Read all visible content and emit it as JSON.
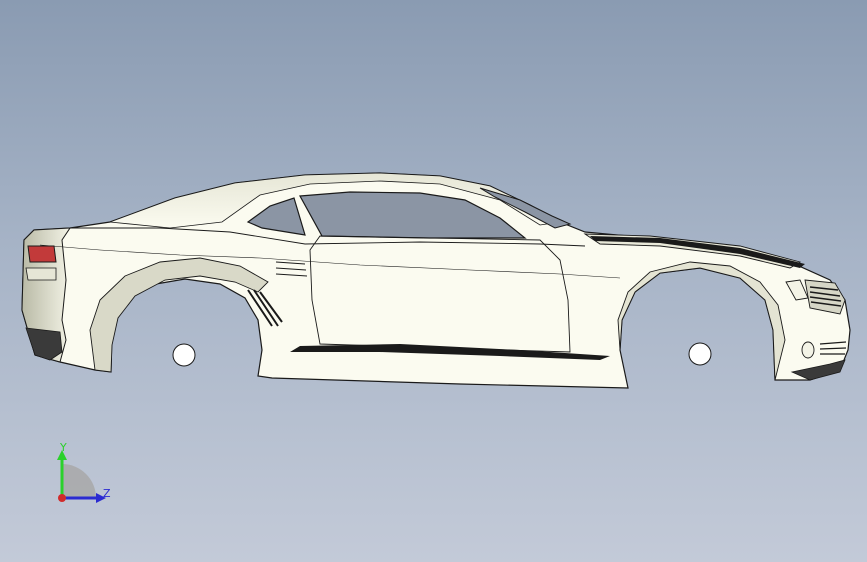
{
  "viewport": {
    "background_top": "#8a9bb2",
    "background_bottom": "#c3cad8",
    "body_color": "#fbfbf0",
    "body_shade": "#c8c9b8",
    "window_color": "#8b95a4",
    "edge_color": "#1a1a1a",
    "taillight_color": "#c23a3a"
  },
  "triad": {
    "y_label": "Y",
    "z_label": "Z",
    "y_color": "#2bd12b",
    "z_color": "#2b2bd1",
    "x_color": "#d12b2b"
  }
}
